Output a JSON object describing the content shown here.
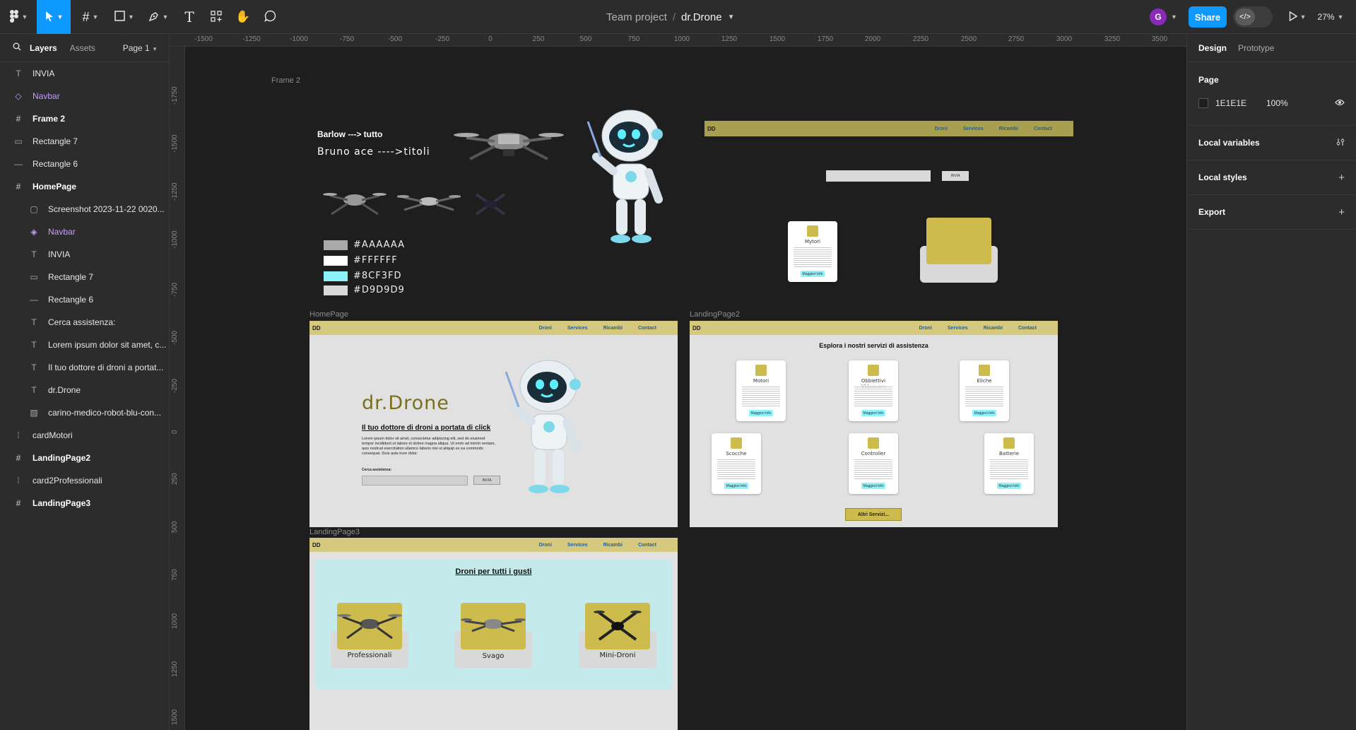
{
  "toolbar": {
    "project": "Team project",
    "separator": "/",
    "file_name": "dr.Drone",
    "avatar_initial": "G",
    "share_label": "Share",
    "dev_mode_icon": "</>",
    "zoom": "27%"
  },
  "left_panel": {
    "tabs": [
      "Layers",
      "Assets"
    ],
    "page_selector": "Page 1",
    "layers": [
      {
        "label": "INVIA",
        "icon": "text-icon"
      },
      {
        "label": "Navbar",
        "icon": "component-icon"
      },
      {
        "label": "Frame 2",
        "icon": "frame-icon"
      },
      {
        "label": "Rectangle 7",
        "icon": "rectangle-icon"
      },
      {
        "label": "Rectangle 6",
        "icon": "line-icon"
      },
      {
        "label": "HomePage",
        "icon": "frame-icon"
      },
      {
        "label": "Screenshot 2023-11-22 0020...",
        "icon": "image-icon"
      },
      {
        "label": "Navbar",
        "icon": "instance-icon"
      },
      {
        "label": "INVIA",
        "icon": "text-icon"
      },
      {
        "label": "Rectangle 7",
        "icon": "rectangle-icon"
      },
      {
        "label": "Rectangle 6",
        "icon": "line-icon"
      },
      {
        "label": "Cerca assistenza:",
        "icon": "text-icon"
      },
      {
        "label": "Lorem ipsum dolor sit amet, c...",
        "icon": "text-icon"
      },
      {
        "label": "Il tuo dottore di droni a portat...",
        "icon": "text-icon"
      },
      {
        "label": "dr.Drone",
        "icon": "text-icon"
      },
      {
        "label": "carino-medico-robot-blu-con...",
        "icon": "image-icon"
      },
      {
        "label": "cardMotori",
        "icon": "group-icon"
      },
      {
        "label": "LandingPage2",
        "icon": "frame-icon"
      },
      {
        "label": "card2Professionali",
        "icon": "group-icon"
      },
      {
        "label": "LandingPage3",
        "icon": "frame-icon"
      }
    ]
  },
  "right_panel": {
    "tabs": [
      "Design",
      "Prototype"
    ],
    "page_section": "Page",
    "page_color": "1E1E1E",
    "page_opacity": "100%",
    "sections": [
      "Local variables",
      "Local styles",
      "Export"
    ]
  },
  "rulers": {
    "top": [
      "-1500",
      "-1250",
      "-1000",
      "-750",
      "-500",
      "-250",
      "0",
      "250",
      "500",
      "750",
      "1000",
      "1250",
      "1500",
      "1750",
      "2000",
      "2250",
      "2500",
      "2750",
      "3000",
      "3250",
      "3500"
    ],
    "left": [
      "-1750",
      "-1500",
      "-1250",
      "-1000",
      "-750",
      "-500",
      "-250",
      "0",
      "250",
      "500",
      "750",
      "1000",
      "1250",
      "1500"
    ]
  },
  "canvas": {
    "frame2_label": "Frame 2",
    "font_note_1": "Barlow ---> tutto",
    "font_note_2": "Bruno ace ---->titoli",
    "palette": [
      {
        "hex": "#AAAAAA",
        "label": "#AAAAAA"
      },
      {
        "hex": "#FFFFFF",
        "label": "#FFFFFF"
      },
      {
        "hex": "#8CF3FD",
        "label": "#8CF3FD"
      },
      {
        "hex": "#D9D9D9",
        "label": "#D9D9D9"
      }
    ],
    "navbar": {
      "logo": "DD",
      "links": [
        "Droni",
        "Services",
        "Ricambi",
        "Contact"
      ]
    },
    "invia_label": "INVIA",
    "card_mytori_title": "Mytori",
    "card_button": "Maggiori Info",
    "homepage": {
      "label": "HomePage",
      "brand": "dr.Drone",
      "tagline": "Il tuo dottore di droni a portata di click",
      "body": "Lorem ipsum dolor sit amet, consectetur adipiscing elit, sed do eiusmod tempor incididunt ut labore et dolore magna aliqua. Ut enim ad minim veniam, quis nostrud exercitation ullamco laboris nisi ut aliquip ex ea commodo consequat. Duis aute irure dolor.",
      "search_label": "Cerca assistenza:",
      "search_button": "INVIA"
    },
    "landing2": {
      "label": "LandingPage2",
      "heading": "Esplora i nostri servizi di assistenza",
      "cards": [
        "Motori",
        "Obbiettivi Videocam",
        "Eliche",
        "Scocche",
        "Controller",
        "Batterie"
      ],
      "more_button": "Altri Servizi..."
    },
    "landing3": {
      "label": "LandingPage3",
      "heading": "Droni per tutti i gusti",
      "categories": [
        "Professionali",
        "Svago",
        "Mini-Droni"
      ]
    }
  },
  "colors": {
    "accent": "#0D99FF",
    "gold": "#CDBB4E",
    "cyan": "#8CF3FD",
    "navbar": "#D4C97F"
  }
}
